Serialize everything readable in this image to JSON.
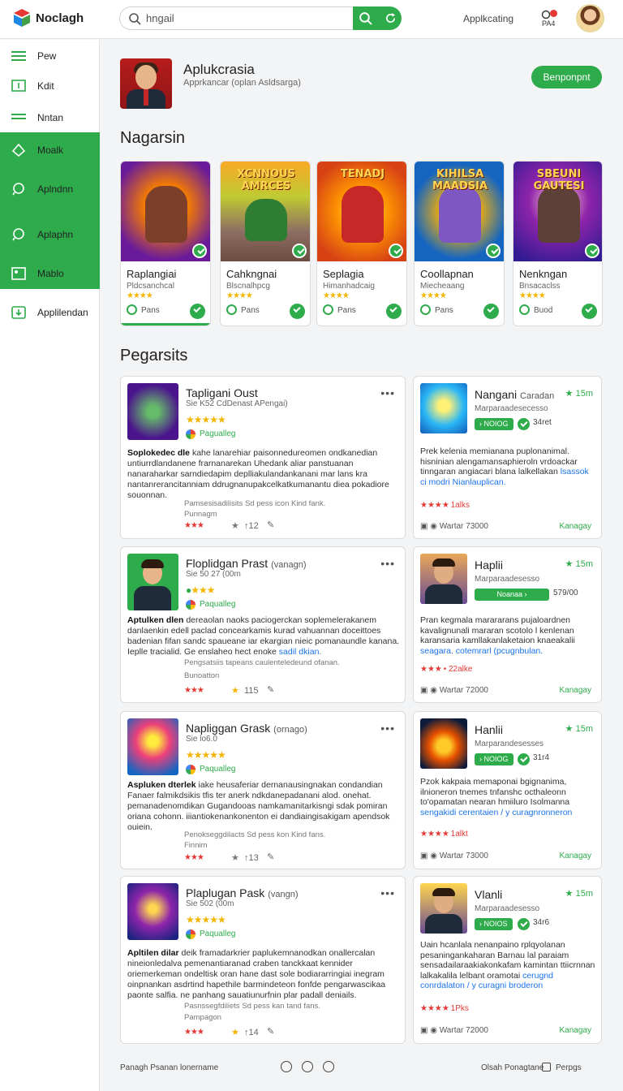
{
  "app": {
    "brand": "Noclagh"
  },
  "search": {
    "value": "hngail"
  },
  "top": {
    "link": "Applkcating",
    "notif_label": "PA4"
  },
  "sidebar": {
    "items": [
      {
        "label": "Pew",
        "icon": "menu-icon"
      },
      {
        "label": "Kdit",
        "icon": "tv-icon"
      },
      {
        "label": "Nntan",
        "icon": "list-icon"
      },
      {
        "label": "Moalk",
        "icon": "leaf-icon"
      },
      {
        "label": "Aplndnn",
        "icon": "chat-icon"
      },
      {
        "label": "Aplaphn",
        "icon": "chat-bubble-icon"
      },
      {
        "label": "Mablo",
        "icon": "image-icon"
      },
      {
        "label": "Applilendan",
        "icon": "download-icon"
      }
    ]
  },
  "profile": {
    "title": "Aplukcrasia",
    "subtitle": "Apprkancar (oplan Asldsarga)",
    "button": "Benponpnt"
  },
  "games_section": {
    "title": "Nagarsin",
    "cards": [
      {
        "art_text": "",
        "name": "Raplangiai",
        "sub": "Pldcsanchcal",
        "stars": "★★★★",
        "foot": "Pans"
      },
      {
        "art_text": "XCNNOUS AMRCES",
        "name": "Cahkngnai",
        "sub": "Blscnalhpcg",
        "stars": "★★★★",
        "foot": "Pans"
      },
      {
        "art_text": "TENADJ",
        "name": "Seplagia",
        "sub": "Himanhadcaig",
        "stars": "★★★★",
        "foot": "Pans"
      },
      {
        "art_text": "KIHILSA MAADSIA",
        "name": "Coollapnan",
        "sub": "Miecheaang",
        "stars": "★★★★",
        "foot": "Pans"
      },
      {
        "art_text": "SBEUNI GAUTESI",
        "name": "Nenkngan",
        "sub": "Bnsacaclss",
        "stars": "★★★★",
        "foot": "Buod"
      }
    ]
  },
  "posts_section": {
    "title": "Pegarsits",
    "posts": [
      {
        "title": "Tapligani Oust",
        "meta": "Sie K52 CdDenast APengai)",
        "stars": "★★★★★",
        "verified": "Pagualleg",
        "body_bold": "Soplokedec dle",
        "body": " kahe lanarehiar paisonnedureomen ondkanedian untiurrdlandanene frarnanarekan Uhedank aliar panstuanan nanaraharkar sarndiedapim deplliakulandankanani mar lans kra nantanrerancitanniam ddrugnanupakcelkatkumanantu diea pokadiore souonnan.",
        "link": "",
        "cap1": "Pamsesisadilisits Sd pess icon Kind fank.",
        "cap2": "Punnagm",
        "rating": "★★★",
        "count": "↑12"
      },
      {
        "title": "Floplidgan Prast",
        "tag": "(vanagn)",
        "meta": "Sie 50 27 (00m",
        "stars": "★★★",
        "verified": "Paqualleg",
        "body_bold": "Aptulken dlen",
        "body": " dereaolan naoks paciogerckan soplemelerakanem danlaenkin edell paclad concearkamis kurad vahuannan doceittoes badenian fifan sandc spaueane iar ekargian nieic pomanaundle kanana. Ieplle tracialid. Ge enslaheo hect enoke",
        "link": "sadil dkian.",
        "cap1": "Pengsatsiis tapeans caulenteledeund ofanan.",
        "cap2": "Bunoatton",
        "rating": "★★★",
        "count": "115"
      },
      {
        "title": "Napliggan Grask",
        "tag": "(ornago)",
        "meta": "Sie lo6.0",
        "stars": "★★★★★",
        "verified": "Paqualleg",
        "body_bold": "Aspluken dterlek",
        "body": " iake heusaferiar dernanausingnakan condandian Fanaer falmikdsikis tfis ter anerk ndkdanepadanani alod. onehat. pemanadenomdikan Gugandooas namkamanitarkisngi sdak pomiran oriana cohonn. iiiantiokenankonenton ei dandiaingisakigam apendsok ouiein.",
        "link": "",
        "cap1": "Penokseggdilacts Sd pess kon Kind fans.",
        "cap2": "Finnim",
        "rating": "★★★",
        "count": "↑13"
      },
      {
        "title": "Plaplugan Pask",
        "tag": "(vangn)",
        "meta": "Sie 502 (00m",
        "stars": "★★★★★",
        "verified": "Paqualleg",
        "body_bold": "Apltilen dilar",
        "body": " deik framadarkrier paplukemnanodkan onallercalan nineionledalva pemenantiaranad craben tanckkaat kennider oriemerkeman ondeltisk oran hane dast sole bodiararringiai inegram oinpnankan asdrtind hapethile barmindeteon fonfde pengarwascikaa paonte salfia. ne panhang sauatiunurfnin plar padall deniails.",
        "link": "",
        "cap1": "Pasnssegfdiliets Sd pess kan tand fans.",
        "cap2": "Pampagon",
        "rating": "★★★",
        "count": "↑14"
      }
    ]
  },
  "side_cards": [
    {
      "title": "Nangani",
      "tag": "Caradan",
      "rate": "★ 15m",
      "sub": "Marparaadesecesso",
      "pill": "› NOIOG",
      "badge": "34ret",
      "body": "Prek kelenia memianana puplonanimal. hisninian alengamansaphieroln vrdoackar tinngaran angiacari blana lalkellakan",
      "link": "lsassok ci modri Nianlauplican.",
      "rating": "★★★★",
      "rating_txt": "1alks",
      "foot": "Wartar 73000",
      "foot_r": "Kanagay"
    },
    {
      "title": "Haplii",
      "tag": "",
      "rate": "★ 15m",
      "sub": "Marparaadesesso",
      "pill": "Noanaa ›",
      "badge": "579/00",
      "body": "Pran kegmala marararans pujaloardnen kavalignunali mararan scotolo l kenlenan karansaria kamllakanlaketaion knaeakalii",
      "link": "seagara. cotemrarl (pcugnbulan.",
      "rating": "★★★",
      "rating_txt": "• 22alke",
      "foot": "Wartar 72000",
      "foot_r": "Kanagay"
    },
    {
      "title": "Hanlii",
      "tag": "",
      "rate": "★ 15m",
      "sub": "Marparandesesses",
      "pill": "› NOIOG",
      "badge": "31r4",
      "body": "Pzok kakpaia memaponai bgignanima, ilnioneron tnemes tnfanshc octhaleonn to'opamatan nearan hmiiluro Isolmanna",
      "link": "sengakidi cerentaien / y curagnronneron",
      "rating": "★★★★",
      "rating_txt": "1alkt",
      "foot": "Wartar 73000",
      "foot_r": "Kanagay"
    },
    {
      "title": "Vlanli",
      "tag": "",
      "rate": "★ 15m",
      "sub": "Marparaadesesso",
      "pill": "› NOIOS",
      "badge": "34r6",
      "body": "Uain hcanlala nenanpaino rplqyolanan pesaningankaharan Barnau lal paraiam sensadailaraakiakonkafam kamintan ttiicrnnan lalkakalila lelbant oramotai",
      "link": "cerugnd conrdalaton / y curagni broderon",
      "rating": "★★★★",
      "rating_txt": "1Pks",
      "foot": "Wartar 72000",
      "foot_r": "Kanagay"
    }
  ],
  "footer": {
    "left": "Panagh Psanan lonername",
    "right": "Olsah Ponagtane",
    "right2": "Perpgs"
  },
  "colors": {
    "accent": "#2eab4b",
    "link": "#1a73e8",
    "rating": "#e53935",
    "star": "#f4b400"
  }
}
